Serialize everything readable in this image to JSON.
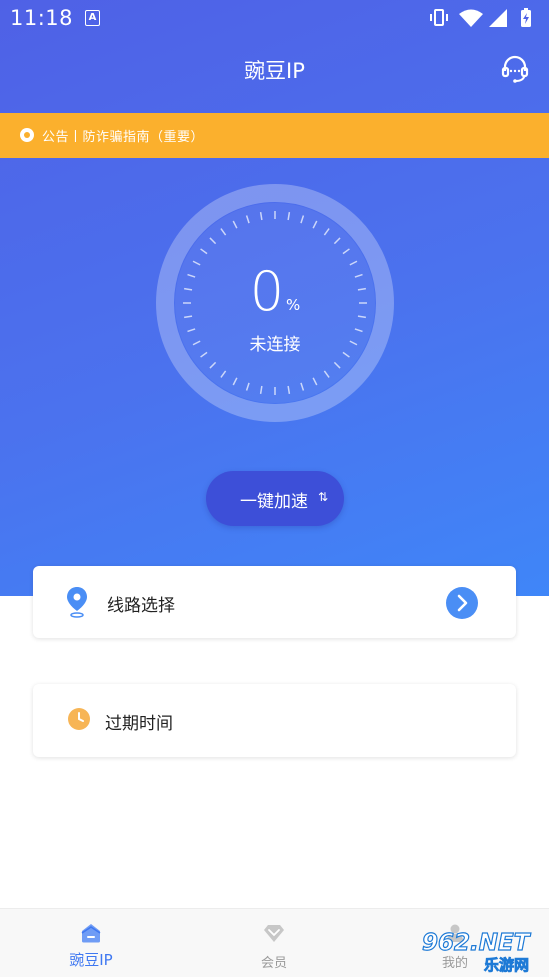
{
  "status_bar": {
    "time": "11:18",
    "icons": [
      "keyboard-a-icon",
      "vibrate-icon",
      "wifi-icon",
      "signal-icon",
      "battery-icon"
    ]
  },
  "header": {
    "title": "豌豆IP",
    "right_icon": "headset-support-icon"
  },
  "notice": {
    "text": "公告丨防诈骗指南（重要）"
  },
  "gauge": {
    "value": "0",
    "unit": "%",
    "status": "未连接",
    "level": 0
  },
  "accelerate": {
    "label": "一键加速",
    "icon": "swap-arrows-icon"
  },
  "cards": {
    "route": {
      "label": "线路选择",
      "icon": "location-pin-icon",
      "action_icon": "chevron-right-icon"
    },
    "expire": {
      "label": "过期时间",
      "icon": "clock-icon"
    }
  },
  "bottom_nav": {
    "items": [
      {
        "label": "豌豆IP",
        "icon": "home-icon"
      },
      {
        "label": "会员",
        "icon": "diamond-icon"
      },
      {
        "label": "我的",
        "icon": "user-icon"
      }
    ]
  },
  "watermark": {
    "brand": "962.NET",
    "sub": "乐游网"
  },
  "colors": {
    "primary": "#4b6ee9",
    "notice": "#fbb02d",
    "active_nav": "#3f78f1",
    "accent_blue": "#4a8ef5",
    "clock": "#f7b556"
  }
}
